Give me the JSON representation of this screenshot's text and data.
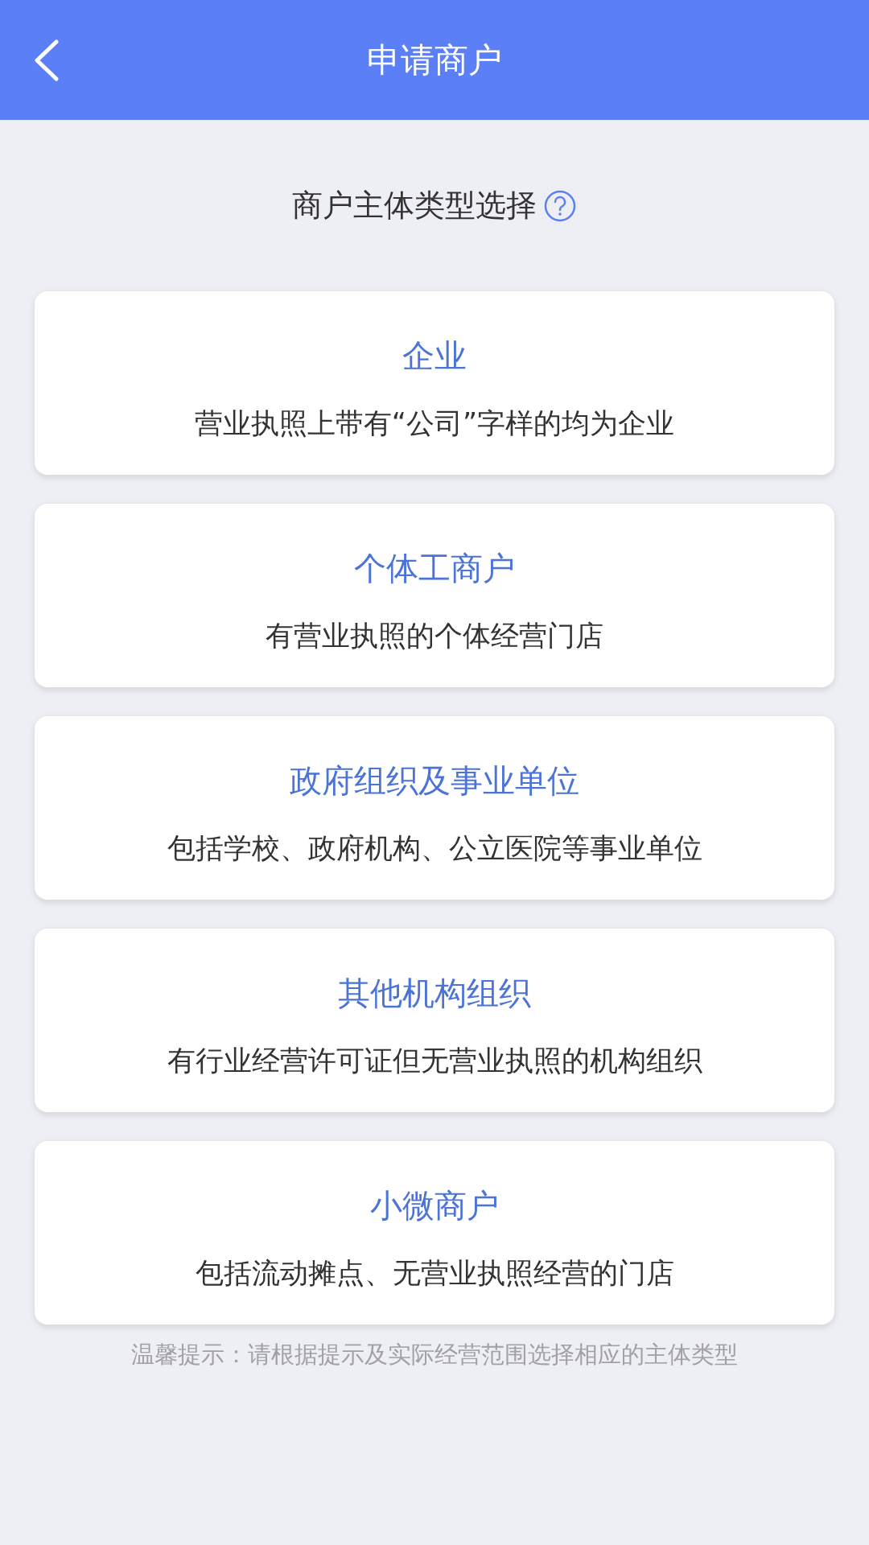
{
  "header": {
    "title": "申请商户"
  },
  "section": {
    "title": "商户主体类型选择"
  },
  "merchant_types": [
    {
      "title": "企业",
      "description": "营业执照上带有“公司”字样的均为企业"
    },
    {
      "title": "个体工商户",
      "description": "有营业执照的个体经营门店"
    },
    {
      "title": "政府组织及事业单位",
      "description": "包括学校、政府机构、公立医院等事业单位"
    },
    {
      "title": "其他机构组织",
      "description": "有行业经营许可证但无营业执照的机构组织"
    },
    {
      "title": "小微商户",
      "description": "包括流动摊点、无营业执照经营的门店"
    }
  ],
  "hint": "温馨提示：请根据提示及实际经营范围选择相应的主体类型"
}
